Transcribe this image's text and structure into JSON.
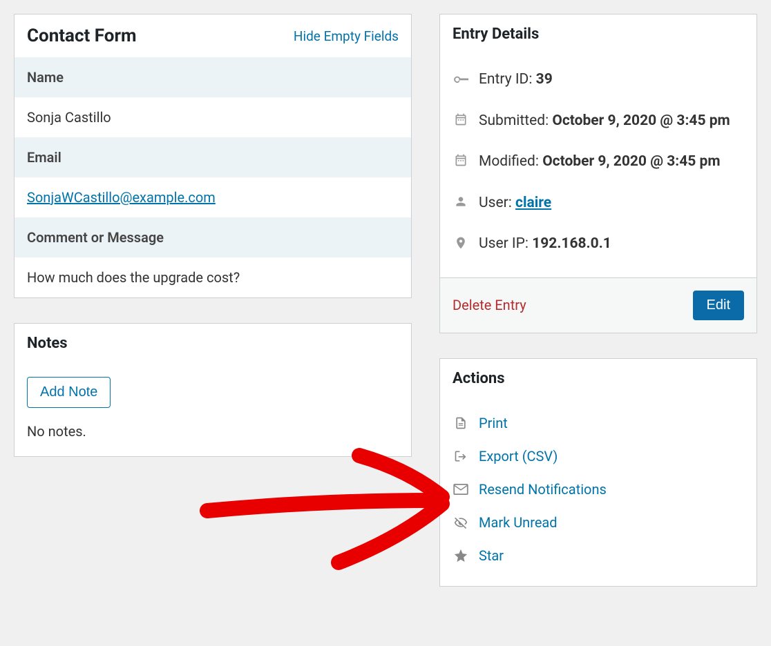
{
  "contactForm": {
    "title": "Contact Form",
    "hideLink": "Hide Empty Fields",
    "fields": {
      "nameLabel": "Name",
      "nameValue": "Sonja Castillo",
      "emailLabel": "Email",
      "emailValue": "SonjaWCastillo@example.com",
      "commentLabel": "Comment or Message",
      "commentValue": "How much does the upgrade cost?"
    }
  },
  "notes": {
    "title": "Notes",
    "addButton": "Add Note",
    "empty": "No notes."
  },
  "entryDetails": {
    "title": "Entry Details",
    "entryIdLabel": "Entry ID: ",
    "entryIdValue": "39",
    "submittedLabel": "Submitted: ",
    "submittedValue": "October 9, 2020 @ 3:45 pm",
    "modifiedLabel": "Modified: ",
    "modifiedValue": "October 9, 2020 @ 3:45 pm",
    "userLabel": "User: ",
    "userValue": "claire",
    "userIpLabel": "User IP: ",
    "userIpValue": "192.168.0.1",
    "deleteLink": "Delete Entry",
    "editButton": "Edit"
  },
  "actions": {
    "title": "Actions",
    "print": "Print",
    "export": "Export (CSV)",
    "resend": "Resend Notifications",
    "markUnread": "Mark Unread",
    "star": "Star"
  }
}
